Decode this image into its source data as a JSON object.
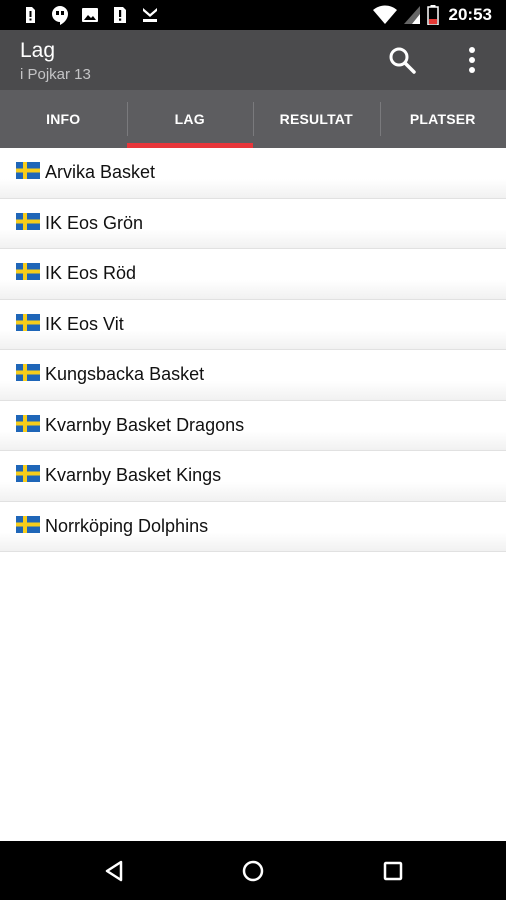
{
  "status_bar": {
    "time": "20:53",
    "left_icons": [
      "sim-alert-icon",
      "hangouts-icon",
      "image-icon",
      "sim-alert-icon",
      "download-icon"
    ],
    "right_icons": [
      "wifi-icon",
      "cell-signal-icon",
      "battery-icon"
    ]
  },
  "app_bar": {
    "title": "Lag",
    "subtitle": "i Pojkar 13",
    "actions": [
      "search-icon",
      "more-vert-icon"
    ]
  },
  "tabs": [
    {
      "label": "INFO",
      "active": false
    },
    {
      "label": "LAG",
      "active": true
    },
    {
      "label": "RESULTAT",
      "active": false
    },
    {
      "label": "PLATSER",
      "active": false
    }
  ],
  "accent_color": "#e8363a",
  "teams": [
    {
      "name": "Arvika Basket",
      "flag": "swedish-flag-icon"
    },
    {
      "name": "IK Eos Grön",
      "flag": "swedish-flag-icon"
    },
    {
      "name": "IK Eos Röd",
      "flag": "swedish-flag-icon"
    },
    {
      "name": "IK Eos Vit",
      "flag": "swedish-flag-icon"
    },
    {
      "name": "Kungsbacka Basket",
      "flag": "swedish-flag-icon"
    },
    {
      "name": "Kvarnby Basket Dragons",
      "flag": "swedish-flag-icon"
    },
    {
      "name": "Kvarnby Basket Kings",
      "flag": "swedish-flag-icon"
    },
    {
      "name": "Norrköping Dolphins",
      "flag": "swedish-flag-icon"
    }
  ],
  "nav_bar": [
    "back-icon",
    "home-icon",
    "recents-icon"
  ]
}
